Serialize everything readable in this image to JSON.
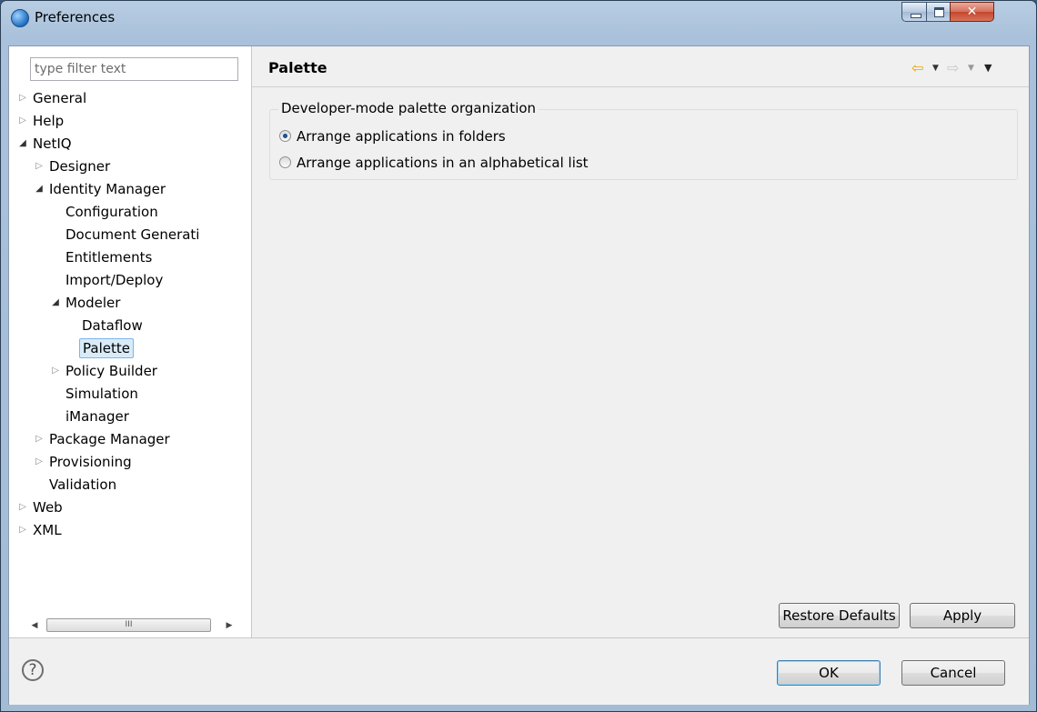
{
  "window": {
    "title": "Preferences"
  },
  "filter": {
    "placeholder": "type filter text"
  },
  "tree": [
    {
      "label": "General",
      "arrow": "collapsed",
      "selected": false
    },
    {
      "label": "Help",
      "arrow": "collapsed",
      "selected": false
    },
    {
      "label": "NetIQ",
      "arrow": "expanded",
      "selected": false
    },
    {
      "label": "Designer",
      "arrow": "collapsed",
      "selected": false
    },
    {
      "label": "Identity Manager",
      "arrow": "expanded",
      "selected": false
    },
    {
      "label": "Configuration",
      "arrow": "none",
      "selected": false
    },
    {
      "label": "Document Generati",
      "arrow": "none",
      "selected": false
    },
    {
      "label": "Entitlements",
      "arrow": "none",
      "selected": false
    },
    {
      "label": "Import/Deploy",
      "arrow": "none",
      "selected": false
    },
    {
      "label": "Modeler",
      "arrow": "expanded",
      "selected": false
    },
    {
      "label": "Dataflow",
      "arrow": "none",
      "selected": false
    },
    {
      "label": "Palette",
      "arrow": "none",
      "selected": true
    },
    {
      "label": "Policy Builder",
      "arrow": "collapsed",
      "selected": false
    },
    {
      "label": "Simulation",
      "arrow": "none",
      "selected": false
    },
    {
      "label": "iManager",
      "arrow": "none",
      "selected": false
    },
    {
      "label": "Package Manager",
      "arrow": "collapsed",
      "selected": false
    },
    {
      "label": "Provisioning",
      "arrow": "collapsed",
      "selected": false
    },
    {
      "label": "Validation",
      "arrow": "none",
      "selected": false
    },
    {
      "label": "Web",
      "arrow": "collapsed",
      "selected": false
    },
    {
      "label": "XML",
      "arrow": "collapsed",
      "selected": false
    }
  ],
  "page": {
    "title": "Palette",
    "group_title": "Developer-mode palette organization",
    "options": [
      {
        "label": "Arrange applications in folders",
        "checked": true
      },
      {
        "label": "Arrange applications in an alphabetical list",
        "checked": false
      }
    ],
    "restore_defaults_label": "Restore Defaults",
    "apply_label": "Apply"
  },
  "footer": {
    "help_glyph": "?",
    "ok_label": "OK",
    "cancel_label": "Cancel"
  },
  "scrollbar": {
    "thumb_grip": "III"
  },
  "icons": {
    "nav_back": "back-arrow-icon",
    "nav_forward": "forward-arrow-icon",
    "view_menu": "view-menu-icon",
    "help": "help-icon",
    "app": "eclipse-app-icon"
  }
}
